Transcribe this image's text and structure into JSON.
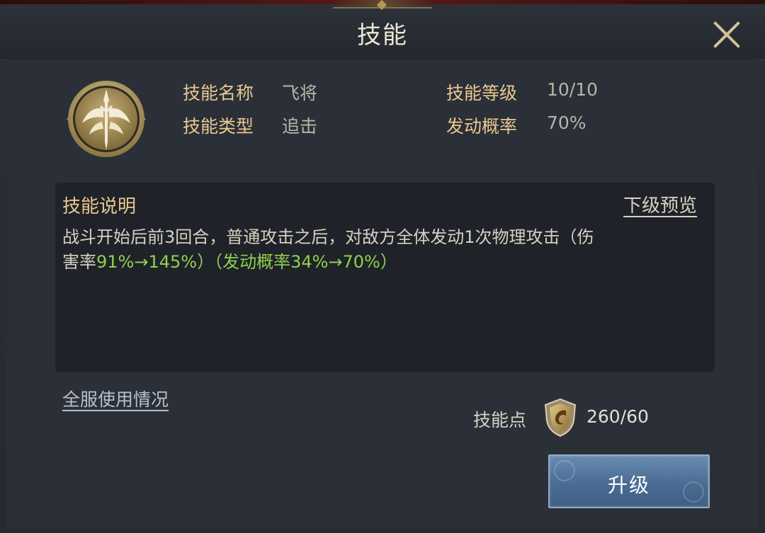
{
  "window": {
    "title": "技能"
  },
  "skill": {
    "name_label": "技能名称",
    "name_value": "飞将",
    "type_label": "技能类型",
    "type_value": "追击",
    "level_label": "技能等级",
    "level_value": "10/10",
    "rate_label": "发动概率",
    "rate_value": "70%"
  },
  "description": {
    "title": "技能说明",
    "next_preview_label": "下级预览",
    "line1": "战斗开始后前3回合，普通攻击之后，对敌方全体发动1次物理攻击（伤",
    "line2_prefix": "害率",
    "line2_green": "91%→145%）（发动概率34%→70%）"
  },
  "footer": {
    "server_usage_label": "全服使用情况",
    "skill_points_label": "技能点",
    "skill_points_value": "260/60",
    "upgrade_label": "升级"
  },
  "colors": {
    "gold_label": "#e8c890",
    "green_highlight": "#8fd14f",
    "button_blue": "#4b6c93"
  },
  "icons": {
    "skill": "winged-sword-emblem-icon",
    "skill_points": "gold-shield-icon",
    "close": "close-icon"
  }
}
